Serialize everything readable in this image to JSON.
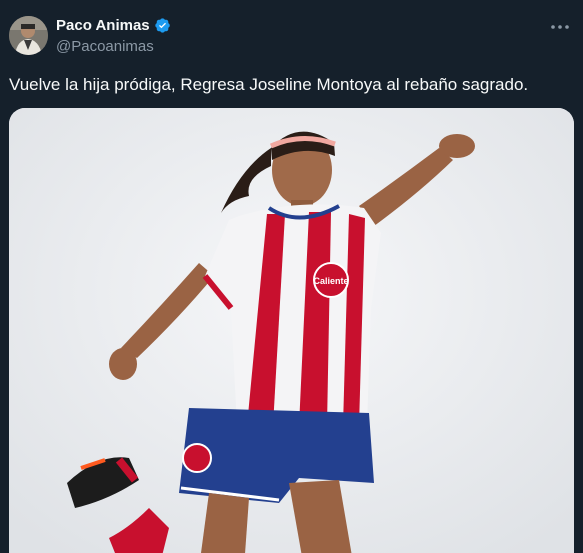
{
  "tweet": {
    "author": {
      "display_name": "Paco Animas",
      "handle": "@Pacoanimas",
      "verified": true,
      "verified_color": "#1d9bf0"
    },
    "text": "Vuelve la hija pródiga, Regresa Joseline Montoya al rebaño sagrado.",
    "media": {
      "type": "photo",
      "jersey_text": "Caliente"
    }
  },
  "colors": {
    "background": "#15202b",
    "text_primary": "#f7f9f9",
    "text_secondary": "#8b98a5",
    "accent": "#1d9bf0",
    "jersey_red": "#c8102e",
    "jersey_blue": "#23408f"
  },
  "icons": {
    "verified": "verified-badge-icon",
    "more": "more-options-icon"
  }
}
